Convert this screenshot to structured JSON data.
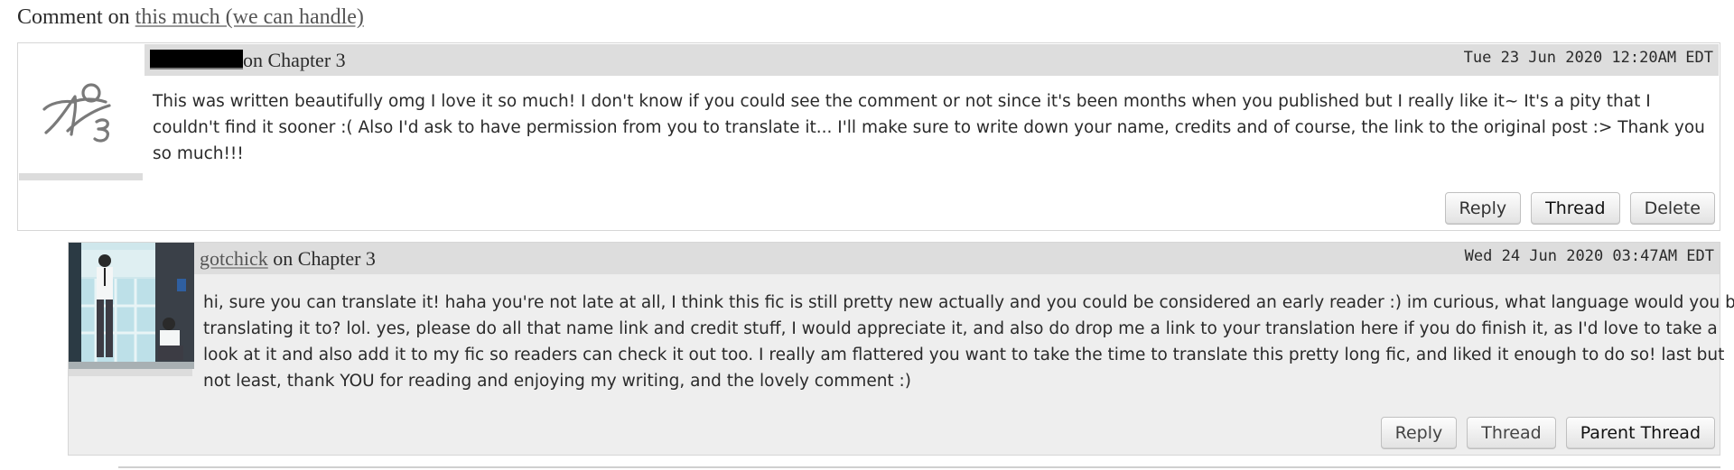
{
  "page": {
    "title_prefix": "Comment on",
    "title_link": "this much (we can handle)"
  },
  "comments": [
    {
      "author": "",
      "chapter": "on Chapter 3",
      "date": "Tue 23 Jun 2020 12:20AM EDT",
      "body": "This was written beautifully omg I love it so much! I don't know if you could see the comment or not since it's been months when you published but I really like it~ It's a pity that I couldn't find it sooner :( Also I'd ask to have permission from you to translate it... I'll make sure to write down your name, credits and of course, the link to the original post :> Thank you so much!!!",
      "actions": [
        "Reply",
        "Thread",
        "Delete"
      ]
    },
    {
      "author": "gotchick",
      "chapter": "on Chapter 3",
      "date": "Wed 24 Jun 2020 03:47AM EDT",
      "body": "hi, sure you can translate it! haha you're not late at all, I think this fic is still pretty new actually and you could be considered an early reader :) im curious, what language would you be translating it to? lol. yes, please do all that name link and credit stuff, I would appreciate it, and also do drop me a link to your translation here if you do finish it, as I'd love to take a look at it and also add it to my fic so readers can check it out too. I really am flattered you want to take the time to translate this pretty long fic, and liked it enough to do so! last but not least, thank YOU for reading and enjoying my writing, and the lovely comment :)",
      "actions": [
        "Reply",
        "Thread",
        "Parent Thread"
      ]
    }
  ],
  "icons": {
    "anonymous_avatar": "ao3-logo-icon",
    "user_avatar": "photo-avatar"
  }
}
